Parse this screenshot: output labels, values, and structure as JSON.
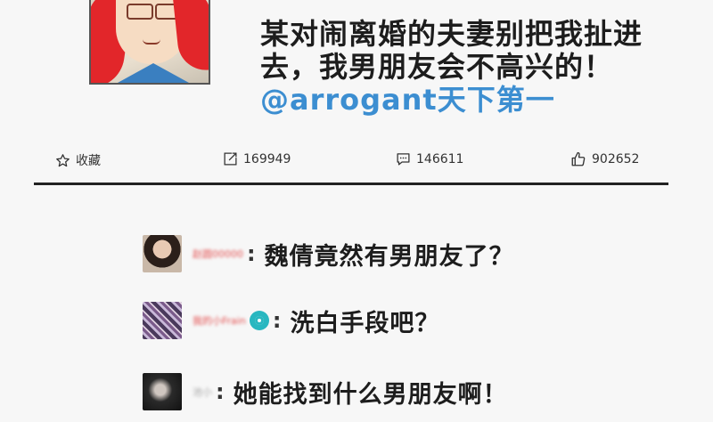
{
  "post": {
    "text": "某对闹离婚的夫妻别把我扯进去，我男朋友会不高兴的！",
    "mention": "@arrogant天下第一"
  },
  "actions": {
    "favorite": "收藏",
    "repost": "169949",
    "comment": "146611",
    "like": "902652"
  },
  "comments": [
    {
      "user": "赵圆00000",
      "text": "魏倩竟然有男朋友了？"
    },
    {
      "user": "我的小Frain",
      "text": "洗白手段吧？"
    },
    {
      "user": "池小",
      "text": "她能找到什么男朋友啊！"
    }
  ],
  "colors": {
    "mention": "#3c8ed1",
    "username": "#e35050"
  }
}
